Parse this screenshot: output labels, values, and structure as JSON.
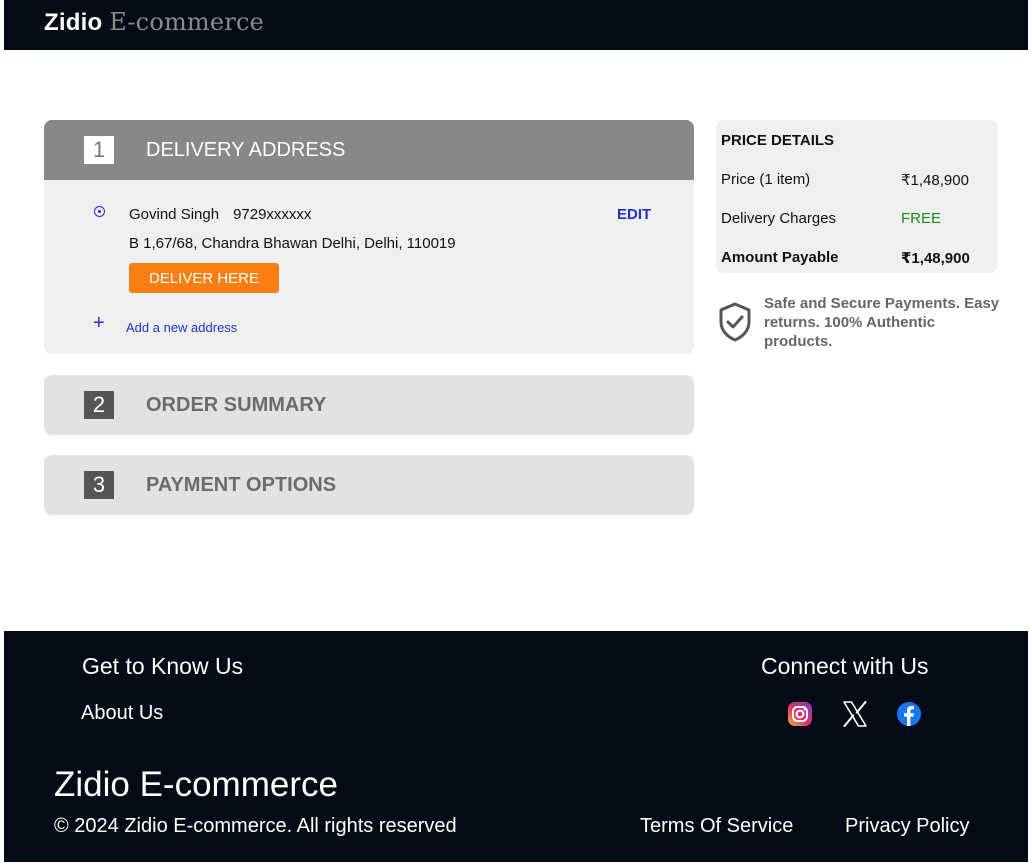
{
  "header": {
    "brand_main": "Zidio",
    "brand_accent": "E-commerce"
  },
  "checkout": {
    "steps": [
      {
        "number": "1",
        "title": "DELIVERY ADDRESS"
      },
      {
        "number": "2",
        "title": "ORDER SUMMARY"
      },
      {
        "number": "3",
        "title": "PAYMENT OPTIONS"
      }
    ],
    "address": {
      "name": "Govind Singh",
      "phone": "9729xxxxxx",
      "edit_label": "EDIT",
      "line": "B 1,67/68, Chandra Bhawan Delhi, Delhi, 110019",
      "deliver_label": "DELIVER HERE",
      "add_new_label": "Add a new address",
      "add_icon": "+"
    }
  },
  "price_details": {
    "title": "PRICE DETAILS",
    "rows": [
      {
        "label": "Price (1 item)",
        "value": "₹1,48,900"
      },
      {
        "label": "Delivery Charges",
        "value": "FREE"
      },
      {
        "label": "Amount Payable",
        "value": "₹1,48,900"
      }
    ]
  },
  "secure_note": "Safe and Secure Payments. Easy returns. 100% Authentic products.",
  "footer": {
    "know_heading": "Get to Know Us",
    "about_label": "About Us",
    "connect_heading": "Connect with Us",
    "brand": "Zidio E-commerce",
    "copyright": "© 2024 Zidio E-commerce. All rights reserved",
    "terms_label": "Terms Of Service",
    "privacy_label": "Privacy Policy",
    "social_icons": [
      "instagram-icon",
      "x-icon",
      "facebook-icon"
    ]
  },
  "colors": {
    "header_bg": "#030c16",
    "accent_orange": "#fb7e10",
    "link_blue": "#2233cc",
    "free_green": "#1a8a1a"
  }
}
